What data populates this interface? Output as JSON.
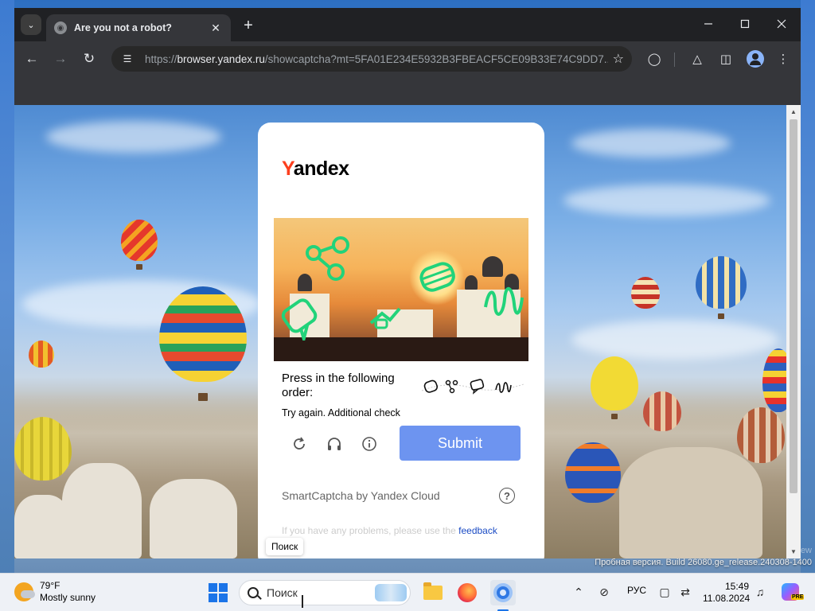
{
  "browser": {
    "tab_title": "Are you not a robot?",
    "new_tab_label": "+",
    "url_scheme": "https://",
    "url_host": "browser.yandex.ru",
    "url_rest": "/showcaptcha?mt=5FA01E234E5932B3FBEACF5CE09B33E74C9DD7..."
  },
  "captcha": {
    "logo_y": "Y",
    "logo_rest": "andex",
    "instruction": "Press in the following order:",
    "retry_message": "Try again. Additional check",
    "submit_label": "Submit",
    "brand": "SmartCaptcha by Yandex Cloud",
    "help_label": "?",
    "problems_text": "If you have any problems, please use the ",
    "feedback_link": "feedback"
  },
  "tooltip": {
    "text": "Поиск"
  },
  "desktop": {
    "trial_note": "Пробная версия. Build 26080.ge_release.240308-1400",
    "trial_ghost": "ew"
  },
  "taskbar": {
    "weather_temp": "79°F",
    "weather_desc": "Mostly sunny",
    "search_placeholder": "Поиск",
    "language": "РУС",
    "time": "15:49",
    "date": "11.08.2024",
    "pre_badge": "PRE"
  },
  "colors": {
    "submit_button": "#6d94f0",
    "yandex_red": "#fc3f1d",
    "glyph_green": "#21d37a",
    "windows_blue": "#1b74e8"
  },
  "icons": {
    "order": [
      "disc-glyph",
      "nodes-glyph",
      "speech-bubble-glyph",
      "wave-glyph"
    ]
  }
}
